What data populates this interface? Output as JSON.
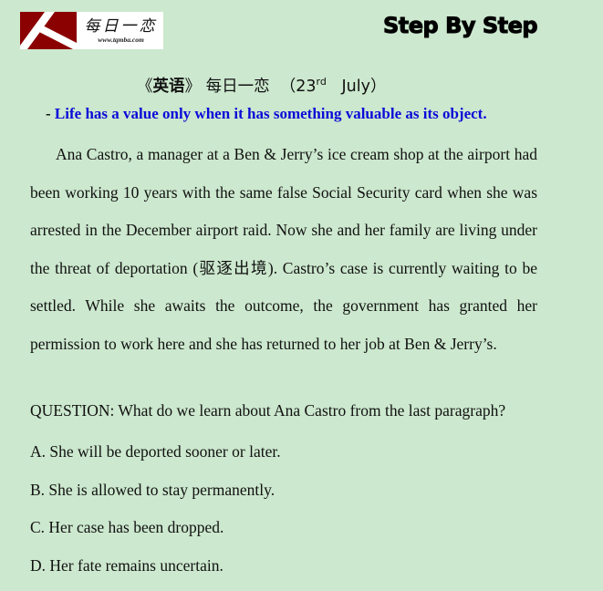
{
  "logo": {
    "icon": "k-logo-icon",
    "chinese_text": "每日一恋",
    "url_text": "www.tqmba.com",
    "brand_color": "#8b0000"
  },
  "header": {
    "brand_title": "Step By Step"
  },
  "title": {
    "open_bracket": "《",
    "subject": "英语",
    "close_bracket": "》",
    "series": "每日一恋",
    "date_open": "（23",
    "date_suffix": "rd",
    "date_month": "July）"
  },
  "motto": {
    "dash": "- ",
    "text": "Life has a value only when it has something valuable as its object.",
    "color": "#0a0ad8"
  },
  "passage": {
    "text": "Ana Castro, a manager at a Ben & Jerry’s ice cream shop at the airport had been working 10 years with the same false Social Security card when she was arrested in the December airport raid. Now she and her family are living under the threat of deportation (驱逐出境). Castro’s case is currently waiting to be settled. While she awaits the outcome, the government has granted her permission to work here and she has returned to her job at Ben & Jerry’s."
  },
  "question": {
    "text": "QUESTION: What do we learn about Ana Castro from the last paragraph?",
    "options": [
      {
        "label": "A. She will be deported sooner or later."
      },
      {
        "label": "B. She is allowed to stay permanently."
      },
      {
        "label": "C. Her case has been dropped."
      },
      {
        "label": "D. Her fate remains uncertain."
      }
    ]
  },
  "colors": {
    "background": "#cce8ce",
    "text": "#111111"
  }
}
